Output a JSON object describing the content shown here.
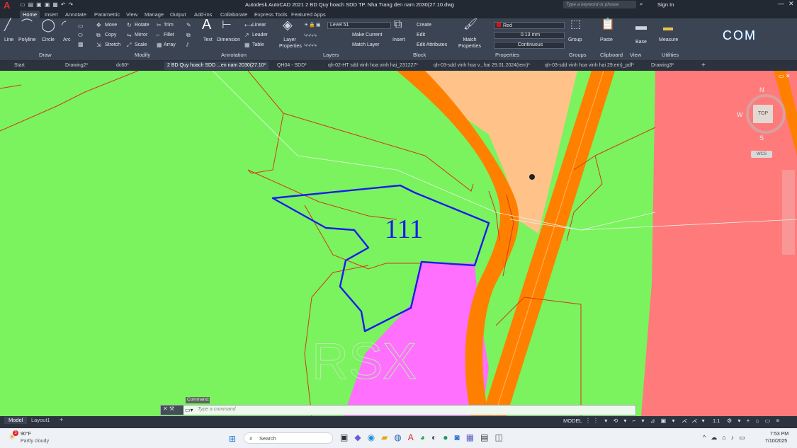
{
  "titlebar": {
    "app_letter": "A",
    "title": "Autodesk AutoCAD 2021   2 BD Quy hoach SDD TP. Nha Trang den nam 2030(27.10.dwg",
    "search_placeholder": "Type a keyword or phrase",
    "sign_in": "Sign In"
  },
  "ribbon_tabs": [
    "Home",
    "Insert",
    "Annotate",
    "Parametric",
    "View",
    "Manage",
    "Output",
    "Add-ins",
    "Collaborate",
    "Express Tools",
    "Featured Apps"
  ],
  "ribbon": {
    "draw": {
      "title": "Draw",
      "line": "Line",
      "polyline": "Polyline",
      "circle": "Circle",
      "arc": "Arc"
    },
    "modify": {
      "title": "Modify",
      "move": "Move",
      "rotate": "Rotate",
      "trim": "Trim",
      "copy": "Copy",
      "mirror": "Mirror",
      "fillet": "Fillet",
      "stretch": "Stretch",
      "scale": "Scale",
      "array": "Array"
    },
    "annotation": {
      "title": "Annotation",
      "text": "Text",
      "dimension": "Dimension",
      "linear": "Linear",
      "leader": "Leader",
      "table": "Table"
    },
    "layers": {
      "title": "Layers",
      "layer_properties": "Layer Properties",
      "current_layer": "Level 51",
      "make_current": "Make Current",
      "match_layer": "Match Layer"
    },
    "block": {
      "title": "Block",
      "insert": "Insert",
      "create": "Create",
      "edit": "Edit",
      "edit_attributes": "Edit Attributes"
    },
    "properties": {
      "title": "Properties",
      "match_properties": "Match Properties",
      "color": "Red",
      "lineweight": "0.13 mm",
      "linetype": "Continuous"
    },
    "groups": {
      "title": "Groups",
      "group": "Group"
    },
    "clipboard": {
      "title": "Clipboard",
      "paste": "Paste"
    },
    "view": {
      "title": "View",
      "base": "Base"
    },
    "utilities": {
      "title": "Utilities",
      "measure": "Measure"
    }
  },
  "doc_tabs": [
    "Start",
    "Drawing2*",
    "dc60*",
    "2 BD Quy hoach SDD ...en nam 2030(27.10*",
    "QH04 - SDD*",
    "qh-02-HT sdd vinh hoa vinh hai_231227*",
    "qh-03-sdd vinh hoa v...hai 29.01.2024(tem)*",
    "qh-03-sdd vinh hoa vinh hai 29.em)_pdf*",
    "Drawing3*"
  ],
  "canvas": {
    "parcel_label": "111",
    "watermark_text": "RSX",
    "compass": {
      "n": "N",
      "s": "S",
      "w": "W",
      "top": "TOP",
      "wcs": "WCS"
    },
    "colors": {
      "green": "#7af35e",
      "orange": "#ff8000",
      "peach": "#ffc38a",
      "pink": "#ff7b7b",
      "magenta": "#ff70ff",
      "blue": "#1a1aee",
      "red": "#d23a1a"
    }
  },
  "command": {
    "label": "Command:",
    "placeholder": "Type a command"
  },
  "layout_tabs": [
    "Model",
    "Layout1"
  ],
  "status": {
    "model": "MODEL",
    "scale": "1:1"
  },
  "taskbar": {
    "weather_temp": "90°F",
    "weather_desc": "Partly cloudy",
    "weather_badge": "3",
    "search": "Search",
    "time": "7:53 PM",
    "date": "7/10/2025"
  },
  "watermark_logo": "COM"
}
